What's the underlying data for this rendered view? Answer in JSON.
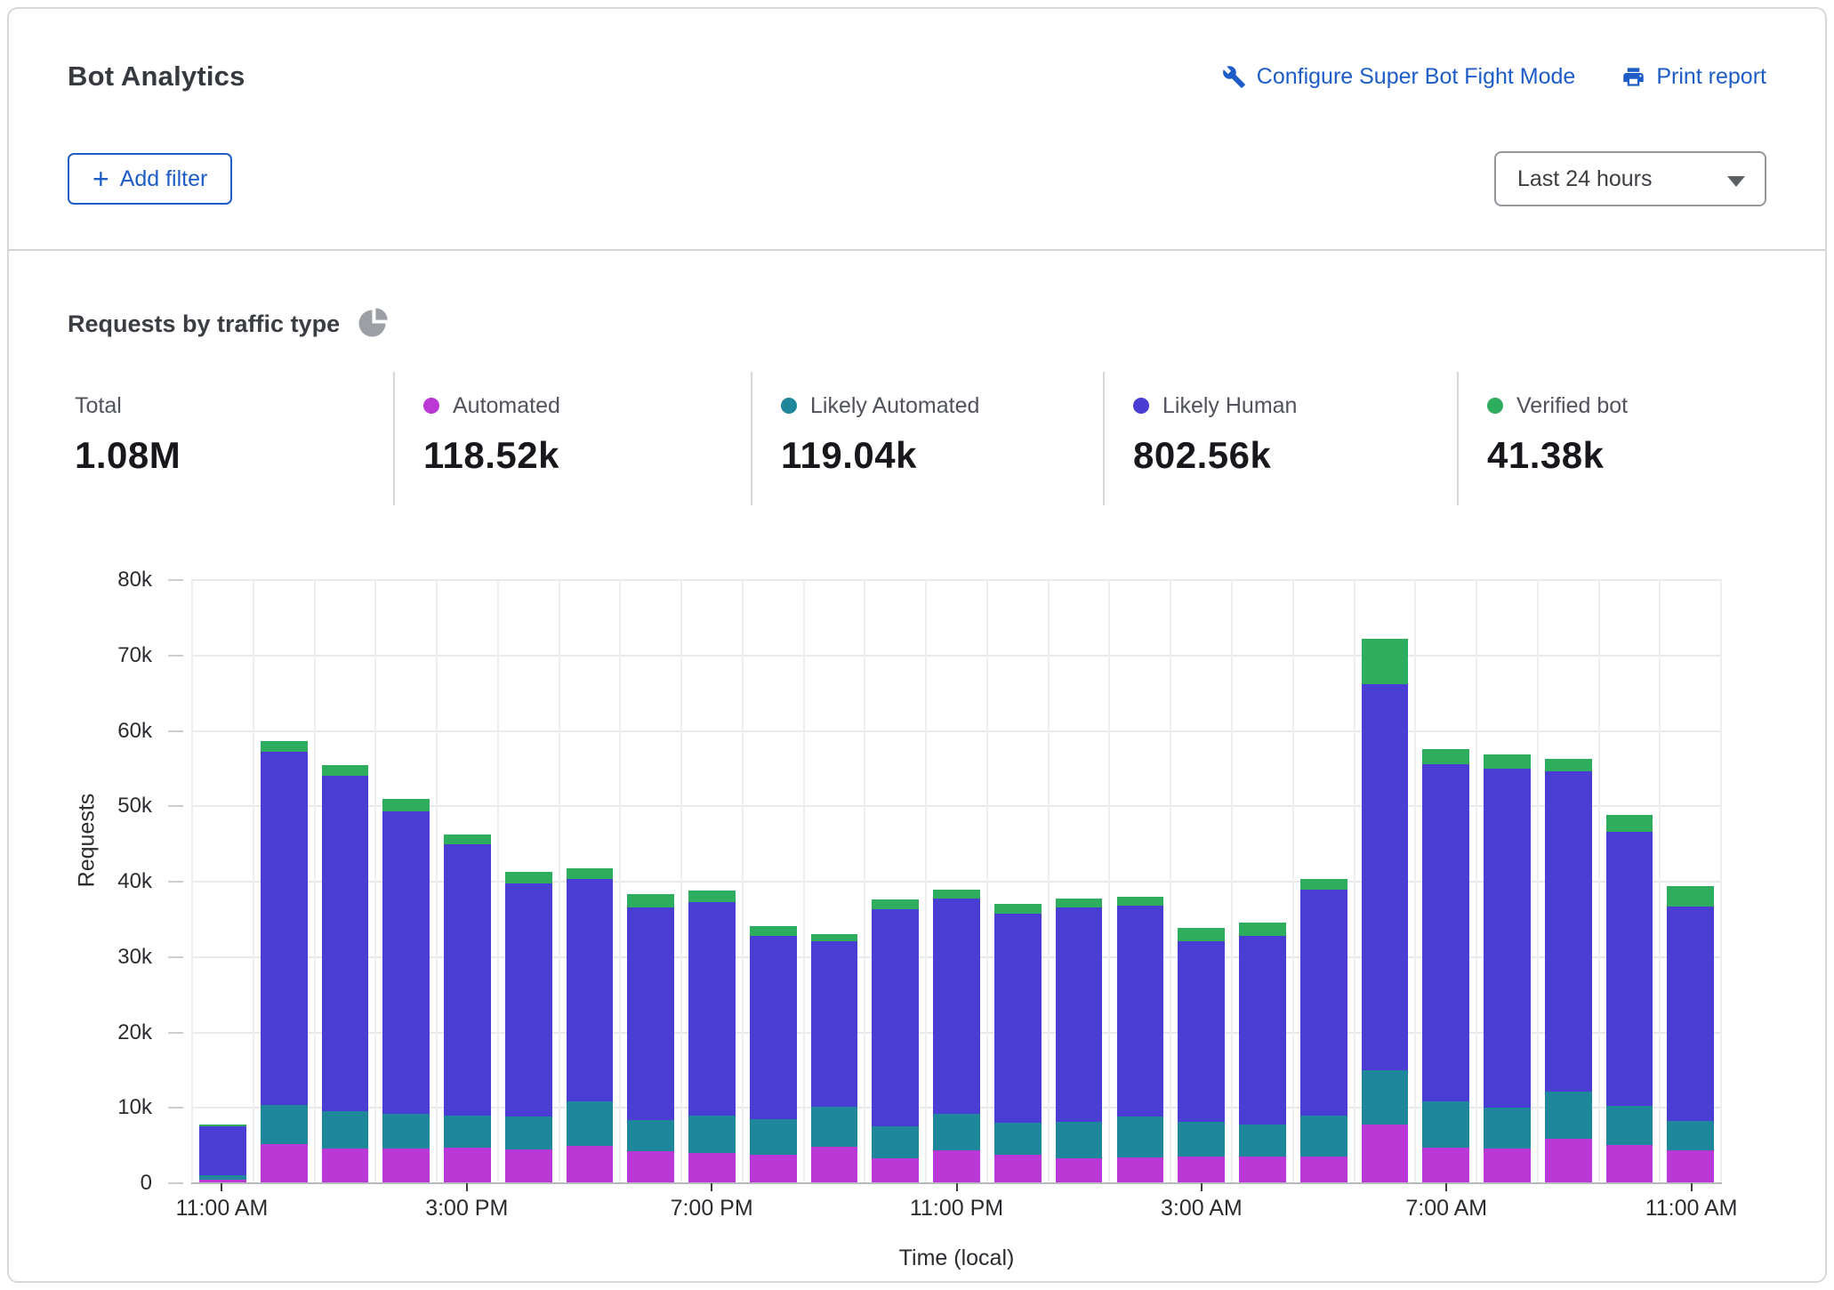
{
  "header": {
    "title": "Bot Analytics",
    "links": [
      {
        "label": "Configure Super Bot Fight Mode",
        "icon": "wrench-icon"
      },
      {
        "label": "Print report",
        "icon": "printer-icon"
      }
    ],
    "add_filter_plus": "+",
    "add_filter_label": "Add filter",
    "time_range": "Last 24 hours"
  },
  "section": {
    "title": "Requests by traffic type",
    "stats": [
      {
        "label": "Total",
        "value": "1.08M",
        "color": ""
      },
      {
        "label": "Automated",
        "value": "118.52k",
        "color": "#ba38d6"
      },
      {
        "label": "Likely Automated",
        "value": "119.04k",
        "color": "#1e879c"
      },
      {
        "label": "Likely Human",
        "value": "802.56k",
        "color": "#4a3dd3"
      },
      {
        "label": "Verified bot",
        "value": "41.38k",
        "color": "#2ead5f"
      }
    ]
  },
  "chart_data": {
    "type": "bar",
    "stacked": true,
    "title": "Requests by traffic type",
    "xlabel": "Time (local)",
    "ylabel": "Requests",
    "ylim": [
      0,
      80000
    ],
    "y_tick_step": 10000,
    "y_ticks": [
      "0",
      "10k",
      "20k",
      "30k",
      "40k",
      "50k",
      "60k",
      "70k",
      "80k"
    ],
    "grid": "horizontal and vertical, light gray",
    "legend_position": "top stats row",
    "categories": [
      "11:00 AM",
      "12:00 PM",
      "1:00 PM",
      "2:00 PM",
      "3:00 PM",
      "4:00 PM",
      "5:00 PM",
      "6:00 PM",
      "7:00 PM",
      "8:00 PM",
      "9:00 PM",
      "10:00 PM",
      "11:00 PM",
      "12:00 AM",
      "1:00 AM",
      "2:00 AM",
      "3:00 AM",
      "4:00 AM",
      "5:00 AM",
      "6:00 AM",
      "7:00 AM",
      "8:00 AM",
      "9:00 AM",
      "10:00 AM",
      "11:00 AM"
    ],
    "x_ticks": [
      {
        "index": 0,
        "label": "11:00 AM"
      },
      {
        "index": 4,
        "label": "3:00 PM"
      },
      {
        "index": 8,
        "label": "7:00 PM"
      },
      {
        "index": 12,
        "label": "11:00 PM"
      },
      {
        "index": 16,
        "label": "3:00 AM"
      },
      {
        "index": 20,
        "label": "7:00 AM"
      },
      {
        "index": 24,
        "label": "11:00 AM"
      }
    ],
    "series": [
      {
        "name": "Automated",
        "color": "#ba38d6",
        "values": [
          500,
          5200,
          4600,
          4600,
          4700,
          4500,
          4900,
          4200,
          4000,
          3800,
          4800,
          3300,
          4400,
          3800,
          3300,
          3400,
          3600,
          3500,
          3500,
          7800,
          4700,
          4600,
          5900,
          5100,
          4400
        ]
      },
      {
        "name": "Likely Automated",
        "color": "#1e879c",
        "values": [
          600,
          5200,
          5000,
          4600,
          4300,
          4300,
          5900,
          4200,
          5000,
          4700,
          5400,
          4300,
          4800,
          4200,
          4900,
          5400,
          4600,
          4300,
          5500,
          7200,
          6200,
          5400,
          6300,
          5200,
          3900
        ]
      },
      {
        "name": "Likely Human",
        "color": "#4a3dd3",
        "values": [
          6400,
          46800,
          44400,
          40100,
          36000,
          31000,
          29500,
          28200,
          28300,
          24300,
          21900,
          28700,
          28600,
          27800,
          28400,
          28000,
          23900,
          25000,
          29900,
          51200,
          44700,
          45000,
          42400,
          36300,
          28400
        ]
      },
      {
        "name": "Verified bot",
        "color": "#2ead5f",
        "values": [
          300,
          1400,
          1500,
          1700,
          1300,
          1500,
          1500,
          1700,
          1500,
          1300,
          1000,
          1300,
          1200,
          1200,
          1200,
          1200,
          1800,
          1800,
          1500,
          6000,
          2000,
          1900,
          1700,
          2200,
          2700
        ]
      }
    ]
  }
}
